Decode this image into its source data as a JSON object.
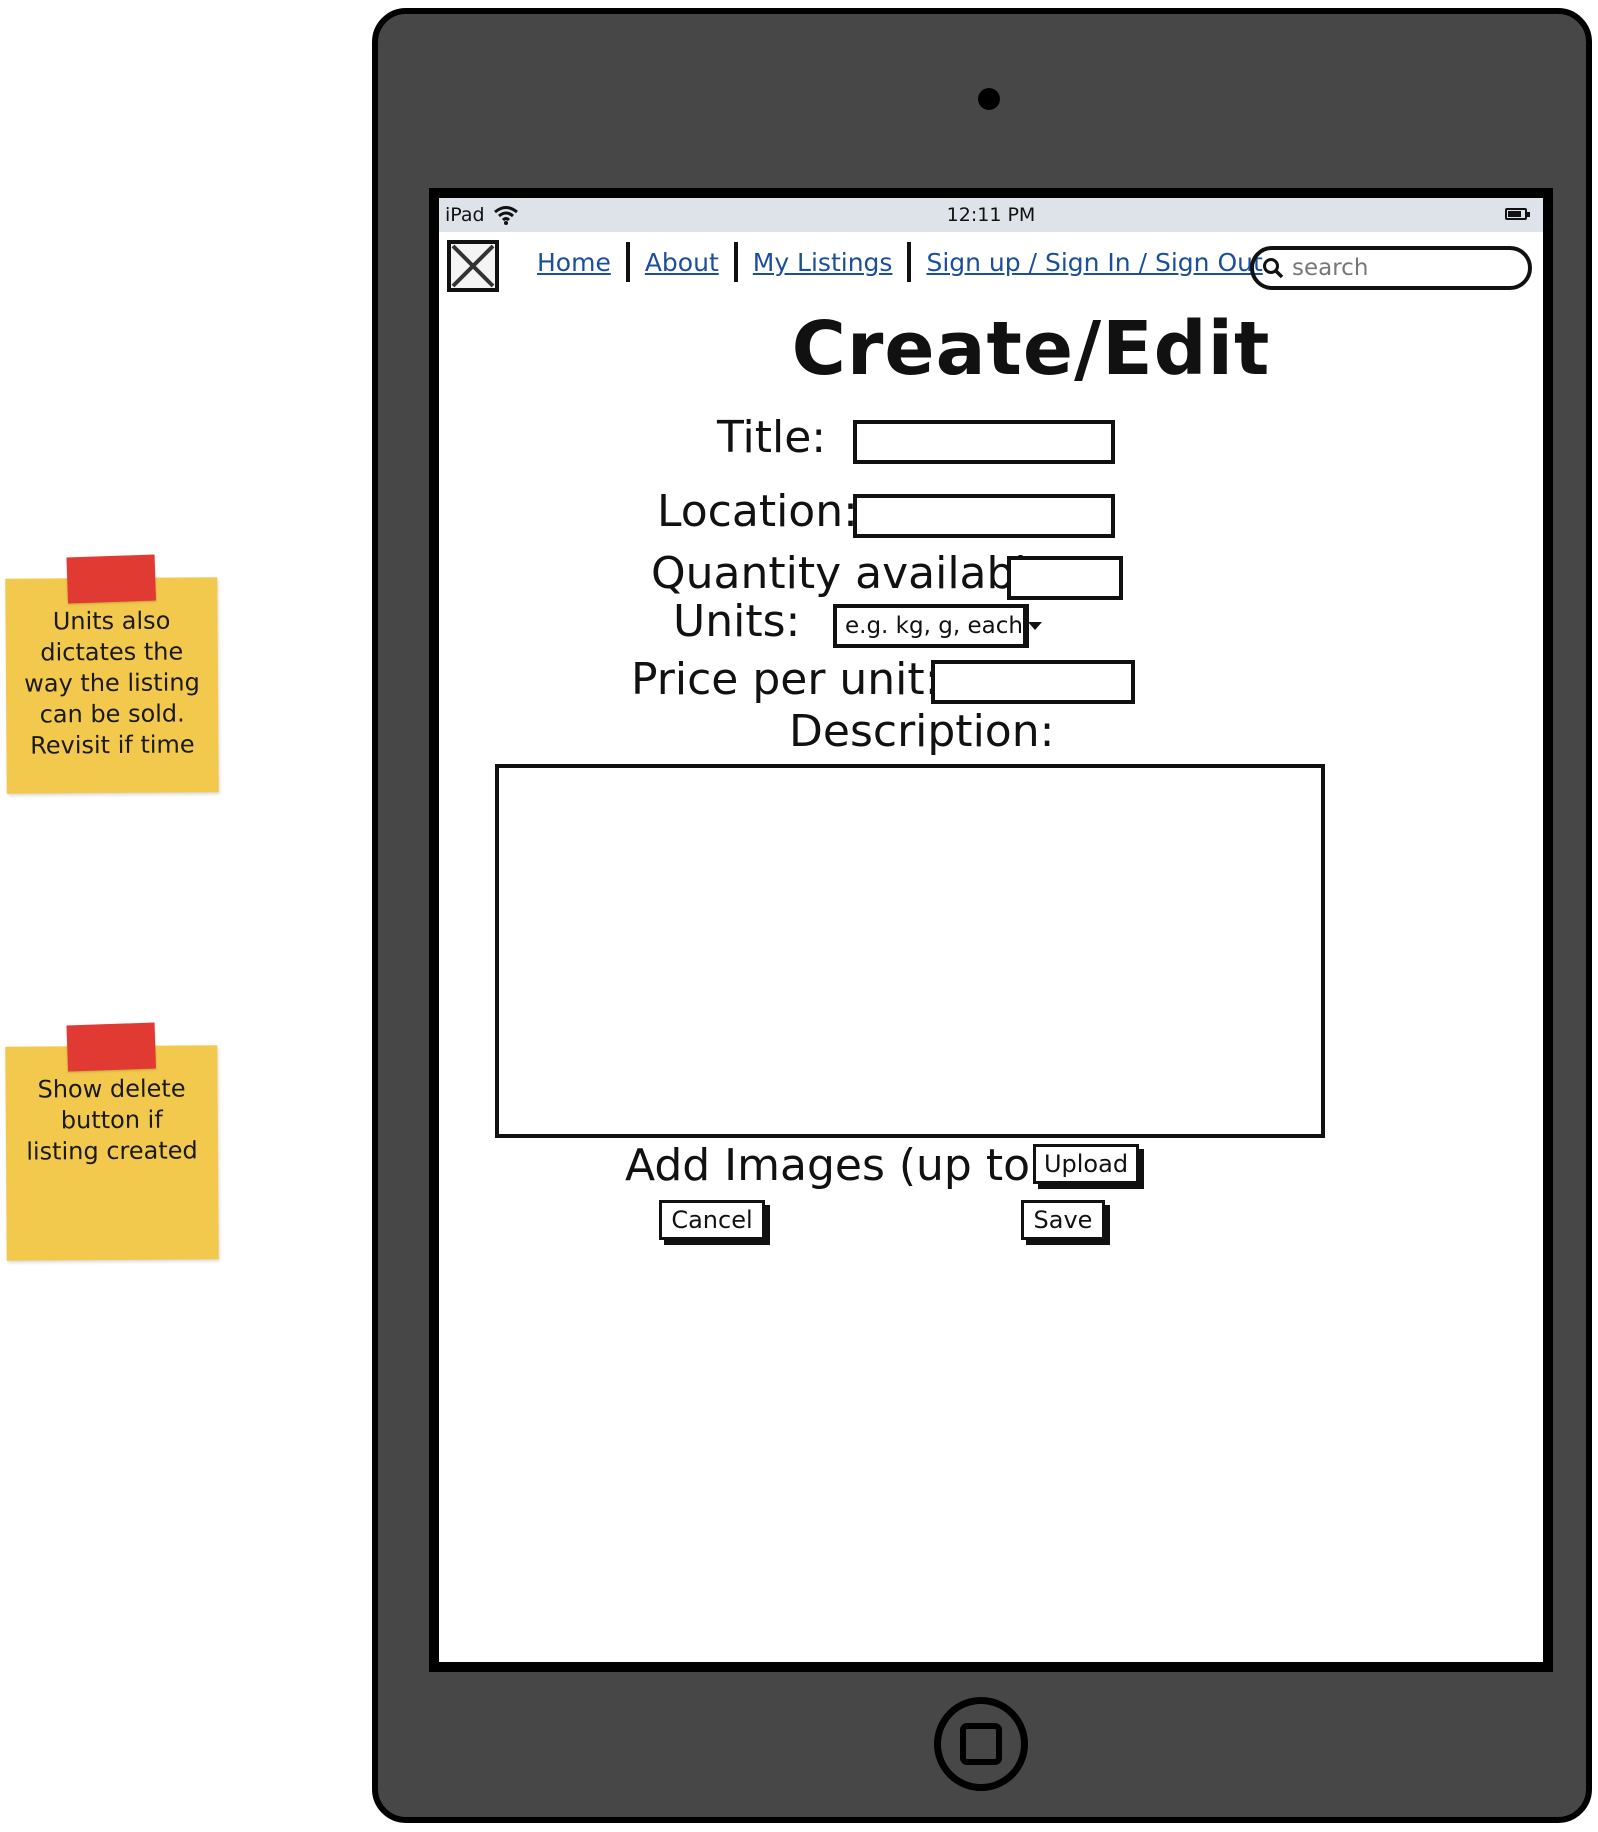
{
  "notes": [
    {
      "text": "Units also\ndictates the\nway the listing\ncan be sold.\nRevisit if time"
    },
    {
      "text": "Show delete\nbutton if\nlisting created"
    }
  ],
  "statusbar": {
    "carrier": "iPad",
    "time": "12:11 PM"
  },
  "nav": {
    "items": [
      {
        "label": "Home"
      },
      {
        "label": "About"
      },
      {
        "label": "My Listings"
      },
      {
        "label": "Sign up / Sign In / Sign Out"
      }
    ]
  },
  "search": {
    "placeholder": "search"
  },
  "page": {
    "title": "Create/Edit"
  },
  "form": {
    "title_label": "Title:",
    "location_label": "Location:",
    "quantity_label": "Quantity available:",
    "units_label": "Units:",
    "units_placeholder": "e.g. kg, g, each",
    "price_label": "Price per unit: $",
    "description_label": "Description:",
    "images_label": "Add Images (up to 5)",
    "upload_label": "Upload",
    "cancel_label": "Cancel",
    "save_label": "Save"
  },
  "colors": {
    "device": "#474747",
    "link": "#1b4f9c",
    "sticky": "#f2c94c",
    "tape": "#e03a32"
  },
  "icons": [
    "wifi-icon",
    "battery-icon",
    "logo-placeholder-icon",
    "search-icon",
    "chevron-down-icon",
    "home-button-icon"
  ]
}
